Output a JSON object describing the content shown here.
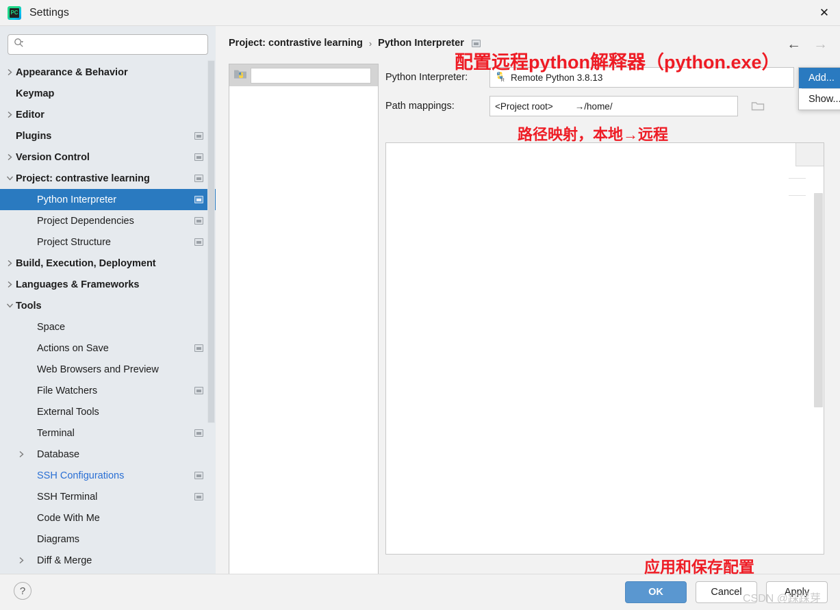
{
  "window": {
    "title": "Settings",
    "app_icon": "pycharm-icon",
    "close_icon": "close-icon"
  },
  "search": {
    "value": "",
    "placeholder": "",
    "icon": "search-icon"
  },
  "sidebar": {
    "items": [
      {
        "label": "Appearance & Behavior",
        "level": 0,
        "bold": true,
        "twisty": "chevron-right",
        "badge": false,
        "selected": false,
        "link": false
      },
      {
        "label": "Keymap",
        "level": 0,
        "bold": true,
        "twisty": "none",
        "badge": false,
        "selected": false,
        "link": false
      },
      {
        "label": "Editor",
        "level": 0,
        "bold": true,
        "twisty": "chevron-right",
        "badge": false,
        "selected": false,
        "link": false
      },
      {
        "label": "Plugins",
        "level": 0,
        "bold": true,
        "twisty": "none",
        "badge": true,
        "selected": false,
        "link": false
      },
      {
        "label": "Version Control",
        "level": 0,
        "bold": true,
        "twisty": "chevron-right",
        "badge": true,
        "selected": false,
        "link": false
      },
      {
        "label": "Project: contrastive learning",
        "level": 0,
        "bold": true,
        "twisty": "chevron-down",
        "badge": true,
        "selected": false,
        "link": false
      },
      {
        "label": "Python Interpreter",
        "level": 1,
        "bold": false,
        "twisty": "none",
        "badge": true,
        "selected": true,
        "link": false
      },
      {
        "label": "Project Dependencies",
        "level": 1,
        "bold": false,
        "twisty": "none",
        "badge": true,
        "selected": false,
        "link": false
      },
      {
        "label": "Project Structure",
        "level": 1,
        "bold": false,
        "twisty": "none",
        "badge": true,
        "selected": false,
        "link": false
      },
      {
        "label": "Build, Execution, Deployment",
        "level": 0,
        "bold": true,
        "twisty": "chevron-right",
        "badge": false,
        "selected": false,
        "link": false
      },
      {
        "label": "Languages & Frameworks",
        "level": 0,
        "bold": true,
        "twisty": "chevron-right",
        "badge": false,
        "selected": false,
        "link": false
      },
      {
        "label": "Tools",
        "level": 0,
        "bold": true,
        "twisty": "chevron-down",
        "badge": false,
        "selected": false,
        "link": false
      },
      {
        "label": "Space",
        "level": 1,
        "bold": false,
        "twisty": "none",
        "badge": false,
        "selected": false,
        "link": false
      },
      {
        "label": "Actions on Save",
        "level": 1,
        "bold": false,
        "twisty": "none",
        "badge": true,
        "selected": false,
        "link": false
      },
      {
        "label": "Web Browsers and Preview",
        "level": 1,
        "bold": false,
        "twisty": "none",
        "badge": false,
        "selected": false,
        "link": false
      },
      {
        "label": "File Watchers",
        "level": 1,
        "bold": false,
        "twisty": "none",
        "badge": true,
        "selected": false,
        "link": false
      },
      {
        "label": "External Tools",
        "level": 1,
        "bold": false,
        "twisty": "none",
        "badge": false,
        "selected": false,
        "link": false
      },
      {
        "label": "Terminal",
        "level": 1,
        "bold": false,
        "twisty": "none",
        "badge": true,
        "selected": false,
        "link": false
      },
      {
        "label": "Database",
        "level": 1,
        "bold": false,
        "twisty": "chevron-right",
        "badge": false,
        "selected": false,
        "link": false
      },
      {
        "label": "SSH Configurations",
        "level": 1,
        "bold": false,
        "twisty": "none",
        "badge": true,
        "selected": false,
        "link": true
      },
      {
        "label": "SSH Terminal",
        "level": 1,
        "bold": false,
        "twisty": "none",
        "badge": true,
        "selected": false,
        "link": false
      },
      {
        "label": "Code With Me",
        "level": 1,
        "bold": false,
        "twisty": "none",
        "badge": false,
        "selected": false,
        "link": false
      },
      {
        "label": "Diagrams",
        "level": 1,
        "bold": false,
        "twisty": "none",
        "badge": false,
        "selected": false,
        "link": false
      },
      {
        "label": "Diff & Merge",
        "level": 1,
        "bold": false,
        "twisty": "chevron-right",
        "badge": false,
        "selected": false,
        "link": false
      }
    ]
  },
  "breadcrumb": {
    "root": "Project: contrastive learning",
    "separator": "›",
    "current": "Python Interpreter",
    "badge_icon": "module-badge-icon"
  },
  "nav": {
    "back_icon": "arrow-left-icon",
    "back_glyph": "←",
    "forward_icon": "arrow-right-icon",
    "forward_glyph": "→"
  },
  "env_panel": {
    "folder_icon": "python-folder-icon",
    "field_value": ""
  },
  "form": {
    "interpreter_label": "Python Interpreter:",
    "interpreter_value": "Remote Python 3.8.13",
    "interpreter_icon": "remote-python-icon",
    "path_mappings_label": "Path mappings:",
    "path_mappings_left": "<Project root>",
    "path_mappings_right": "→/home/",
    "folder_button_icon": "folder-icon"
  },
  "popup": {
    "items": [
      {
        "label": "Add...",
        "active": true
      },
      {
        "label": "Show...",
        "active": false
      }
    ]
  },
  "footer": {
    "help_icon": "help-icon",
    "help_glyph": "?",
    "ok_label": "OK",
    "cancel_label": "Cancel",
    "apply_label": "Apply"
  },
  "annotations": {
    "interpreter": "配置远程python解释器（python.exe）",
    "path_mapping": "路径映射，本地→远程",
    "apply": "应用和保存配置",
    "color": "#ee1c25"
  },
  "watermark": "CSDN @踩踩芽",
  "colors": {
    "selection_blue": "#2a7ac0",
    "sidebar_bg": "#e6eaee",
    "panel_bg": "#f2f2f2",
    "link_blue": "#2a6fd4",
    "primary_button": "#5a97d0",
    "annotation_red": "#ee1c25"
  }
}
